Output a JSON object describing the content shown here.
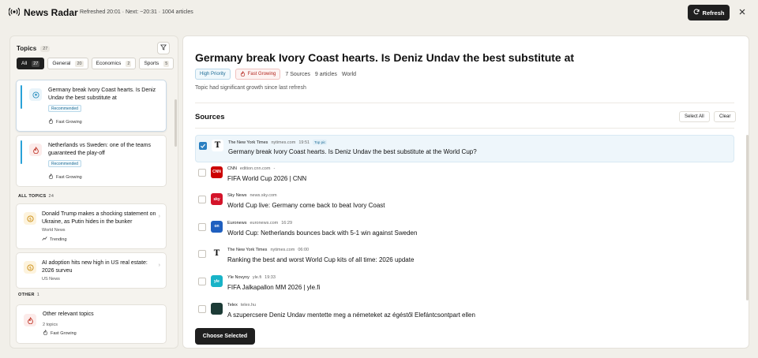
{
  "app": {
    "name": "News Radar",
    "status": "Refreshed 20:01 · Next: ~20:31 · 1004 articles",
    "refresh_label": "Refresh"
  },
  "left": {
    "title": "Topics",
    "count": "27",
    "chips": [
      {
        "label": "All",
        "n": "27"
      },
      {
        "label": "General",
        "n": "20"
      },
      {
        "label": "Economics",
        "n": "2"
      },
      {
        "label": "Sports",
        "n": "5"
      }
    ],
    "featured": [
      {
        "title": "Germany break Ivory Coast hearts. Is Deniz Undav the best substitute at",
        "tag": "Recommended",
        "meta": "Fast Growing"
      },
      {
        "title": "Netherlands vs Sweden: one of the teams guaranteed the play-off",
        "tag": "Recommended",
        "meta": "Fast Growing"
      }
    ],
    "all_label": "ALL TOPICS",
    "all_count": "24",
    "all": [
      {
        "title": "Donald Trump makes a shocking statement on Ukraine, as Putin hides in the bunker",
        "src": "World News",
        "meta": "Trending"
      },
      {
        "title": "AI adoption hits new high in US real estate: 2026 surveu",
        "src": "US News"
      }
    ],
    "other_label": "OTHER",
    "other_count": "1",
    "other": {
      "title": "Other relevant topics",
      "sub": "2 topics",
      "meta": "Fast Growing"
    }
  },
  "main": {
    "title": "Germany break Ivory Coast hearts. Is Deniz Undav the best substitute at",
    "badge_priority": "High Priority",
    "badge_growing": "Fast Growing",
    "sources_count": "7 Sources",
    "articles_count": "9 articles",
    "category": "World",
    "description": "Topic had significant growth since last refresh",
    "sources_title": "Sources",
    "select_all": "Select All",
    "clear": "Clear",
    "choose": "Choose Selected",
    "sources": [
      {
        "name": "The New York Times",
        "domain": "nytimes.com",
        "time": "19:51",
        "badge": "Top pic",
        "headline": "Germany break Ivory Coast hearts. Is Deniz Undav the best substitute at the World Cup?",
        "logo": "T",
        "logo_color": "#ffffff",
        "selected": true
      },
      {
        "name": "CNN",
        "domain": "edition.cnn.com",
        "time": "-",
        "headline": "FIFA World Cup 2026 | CNN",
        "logo": "CNN",
        "logo_color": "#cc0000"
      },
      {
        "name": "Sky News",
        "domain": "news.sky.com",
        "time": "",
        "headline": "World Cup live: Germany come back to beat Ivory Coast",
        "logo": "sky",
        "logo_color": "#d4142a"
      },
      {
        "name": "Euronews",
        "domain": "euronews.com",
        "time": "16:29",
        "headline": "World Cup: Netherlands bounces back with 5-1 win against Sweden",
        "logo": "on",
        "logo_color": "#1f5fbf"
      },
      {
        "name": "The New York Times",
        "domain": "nytimes.com",
        "time": "06:00",
        "headline": "Ranking the best and worst World Cup kits of all time: 2026 update",
        "logo": "T",
        "logo_color": "#ffffff"
      },
      {
        "name": "Yle Novyny",
        "domain": "yle.fi",
        "time": "19:33",
        "headline": "FIFA Jalkapallon MM 2026 | yle.fi",
        "logo": "yle",
        "logo_color": "#18b3c7"
      },
      {
        "name": "Telex",
        "domain": "telex.hu",
        "time": "",
        "headline": "A szupercsere Deniz Undav mentette meg a németeket az égéstől Elefántcsontpart ellen",
        "logo": "",
        "logo_color": "#1c3b36"
      }
    ]
  }
}
